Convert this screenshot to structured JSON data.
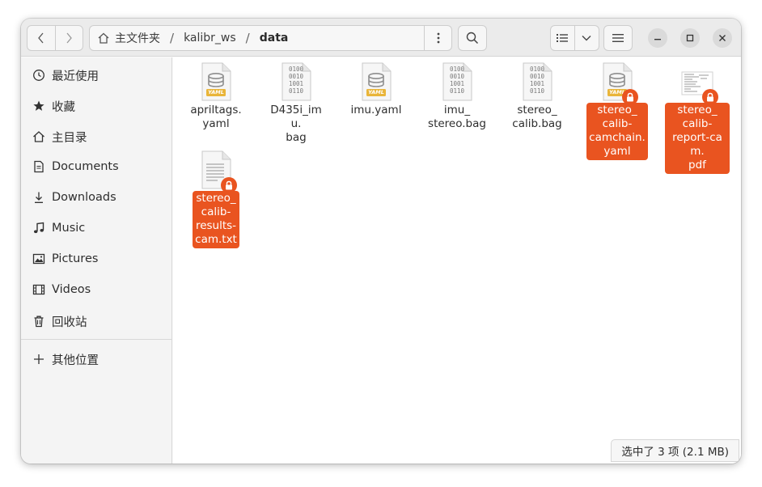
{
  "header": {
    "path": [
      "主文件夹",
      "kalibr_ws",
      "data"
    ],
    "separator": "/"
  },
  "sidebar": {
    "items": [
      {
        "label": "最近使用",
        "icon": "clock-icon"
      },
      {
        "label": "收藏",
        "icon": "star-icon"
      },
      {
        "label": "主目录",
        "icon": "home-icon"
      },
      {
        "label": "Documents",
        "icon": "document-icon"
      },
      {
        "label": "Downloads",
        "icon": "download-icon"
      },
      {
        "label": "Music",
        "icon": "music-icon"
      },
      {
        "label": "Pictures",
        "icon": "picture-icon"
      },
      {
        "label": "Videos",
        "icon": "video-icon"
      },
      {
        "label": "回收站",
        "icon": "trash-icon"
      },
      {
        "label": "其他位置",
        "icon": "plus-icon"
      }
    ]
  },
  "files": [
    {
      "name": "apriltags.yaml",
      "label_lines": [
        "apriltags.",
        "yaml"
      ],
      "type": "yaml",
      "selected": false,
      "locked": false
    },
    {
      "name": "D435i_imu.bag",
      "label_lines": [
        "D435i_imu.",
        "bag"
      ],
      "type": "binary",
      "selected": false,
      "locked": false
    },
    {
      "name": "imu.yaml",
      "label_lines": [
        "imu.yaml"
      ],
      "type": "yaml",
      "selected": false,
      "locked": false
    },
    {
      "name": "imu_stereo.bag",
      "label_lines": [
        "imu_",
        "stereo.bag"
      ],
      "type": "binary",
      "selected": false,
      "locked": false
    },
    {
      "name": "stereo_calib.bag",
      "label_lines": [
        "stereo_",
        "calib.bag"
      ],
      "type": "binary",
      "selected": false,
      "locked": false
    },
    {
      "name": "stereo_calib-camchain.yaml",
      "label_lines": [
        "stereo_",
        "calib-",
        "camchain.",
        "yaml"
      ],
      "type": "yaml",
      "selected": true,
      "locked": true
    },
    {
      "name": "stereo_calib-report-cam.pdf",
      "label_lines": [
        "stereo_",
        "calib-",
        "report-cam.",
        "pdf"
      ],
      "type": "pdf",
      "selected": true,
      "locked": true
    },
    {
      "name": "stereo_calib-results-cam.txt",
      "label_lines": [
        "stereo_",
        "calib-",
        "results-",
        "cam.txt"
      ],
      "type": "text",
      "selected": true,
      "locked": true
    }
  ],
  "binary_icon_text": [
    "0100",
    "0010",
    "1001",
    "0110"
  ],
  "yaml_badge": "YAML",
  "status": "选中了 3 项 (2.1 MB)",
  "colors": {
    "accent": "#e95420",
    "headerbar": "#ebebeb",
    "sidebar": "#f4f4f4"
  }
}
